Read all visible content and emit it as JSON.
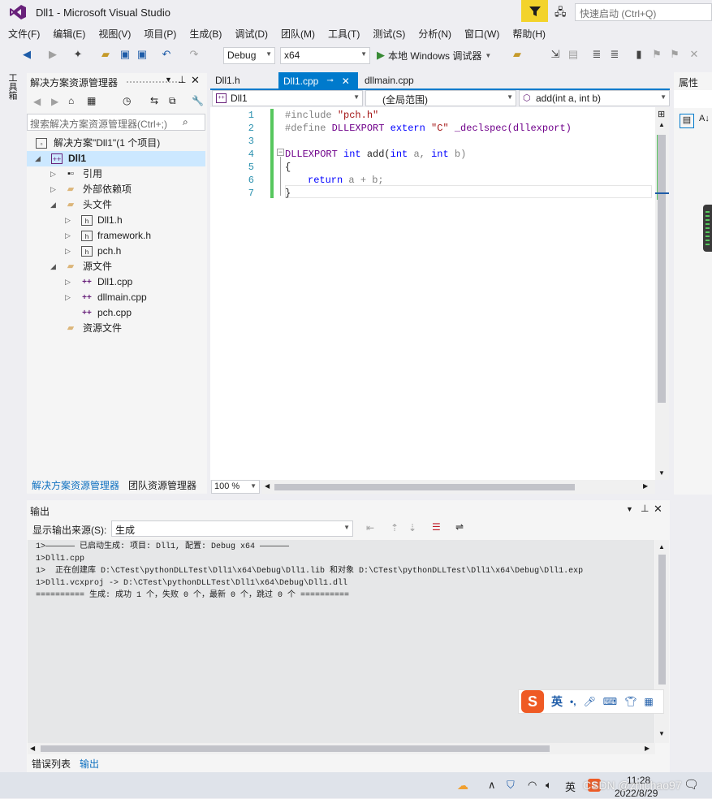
{
  "window": {
    "title": "Dll1 - Microsoft Visual Studio",
    "quick_launch": "快速启动 (Ctrl+Q)"
  },
  "menu": [
    "文件(F)",
    "编辑(E)",
    "视图(V)",
    "项目(P)",
    "生成(B)",
    "调试(D)",
    "团队(M)",
    "工具(T)",
    "测试(S)",
    "分析(N)",
    "窗口(W)",
    "帮助(H)"
  ],
  "toolbar": {
    "config": "Debug",
    "platform": "x64",
    "run_label": "本地 Windows 调试器"
  },
  "left_strip": {
    "label": "工具箱"
  },
  "solution_explorer": {
    "title": "解决方案资源管理器",
    "search_placeholder": "搜索解决方案资源管理器(Ctrl+;)",
    "items": [
      {
        "label": "解决方案\"Dll1\"(1 个项目)",
        "icon": "solution-icon"
      },
      {
        "label": "Dll1",
        "icon": "project-icon"
      },
      {
        "label": "引用",
        "icon": "references-icon"
      },
      {
        "label": "外部依赖项",
        "icon": "folder-icon"
      },
      {
        "label": "头文件",
        "icon": "folder-icon"
      },
      {
        "label": "Dll1.h",
        "icon": "header-file-icon"
      },
      {
        "label": "framework.h",
        "icon": "header-file-icon"
      },
      {
        "label": "pch.h",
        "icon": "header-file-icon"
      },
      {
        "label": "源文件",
        "icon": "folder-icon"
      },
      {
        "label": "Dll1.cpp",
        "icon": "cpp-file-icon"
      },
      {
        "label": "dllmain.cpp",
        "icon": "cpp-file-icon"
      },
      {
        "label": "pch.cpp",
        "icon": "cpp-file-icon"
      },
      {
        "label": "资源文件",
        "icon": "folder-icon"
      }
    ],
    "bottom_tabs": [
      "解决方案资源管理器",
      "团队资源管理器"
    ]
  },
  "editor": {
    "tabs": [
      "Dll1.h",
      "Dll1.cpp",
      "dllmain.cpp"
    ],
    "active_tab": "Dll1.cpp",
    "nav_project": "Dll1",
    "nav_scope": "(全局范围)",
    "nav_member": "add(int a, int b)",
    "zoom": "100 %",
    "line_numbers": [
      "1",
      "2",
      "3",
      "4",
      "5",
      "6",
      "7"
    ],
    "code": {
      "l1a": "#include ",
      "l1b": "\"pch.h\"",
      "l2a": "#define ",
      "l2b": "DLLEXPORT ",
      "l2c": "extern ",
      "l2d": "\"C\" ",
      "l2e": "_declspec",
      "l2f": "(dllexport)",
      "l4a": "DLLEXPORT ",
      "l4b": "int ",
      "l4c": "add(",
      "l4d": "int ",
      "l4e": "a, ",
      "l4f": "int ",
      "l4g": "b)",
      "l5": "{",
      "l6a": "return ",
      "l6b": "a + b;",
      "l7": "}"
    }
  },
  "properties": {
    "title": "属性"
  },
  "output": {
    "title": "输出",
    "source_label": "显示输出来源(S):",
    "source_value": "生成",
    "lines": [
      "1>—————— 已启动生成: 项目: Dll1, 配置: Debug x64 ——————",
      "1>Dll1.cpp",
      "1>  正在创建库 D:\\CTest\\pythonDLLTest\\Dll1\\x64\\Debug\\Dll1.lib 和对象 D:\\CTest\\pythonDLLTest\\Dll1\\x64\\Debug\\Dll1.exp",
      "1>Dll1.vcxproj -> D:\\CTest\\pythonDLLTest\\Dll1\\x64\\Debug\\Dll1.dll",
      "========== 生成: 成功 1 个，失败 0 个，最新 0 个，跳过 0 个 =========="
    ],
    "bottom_tabs": [
      "错误列表",
      "输出"
    ]
  },
  "ime": {
    "lang": "英"
  },
  "taskbar": {
    "time": "11:28",
    "date": "2022/8/29",
    "ime": "英",
    "watermark": "CSDN @zhichao97"
  },
  "colors": {
    "accent": "#007acc",
    "vs_purple": "#68217a",
    "green_bar": "#57c75e"
  }
}
